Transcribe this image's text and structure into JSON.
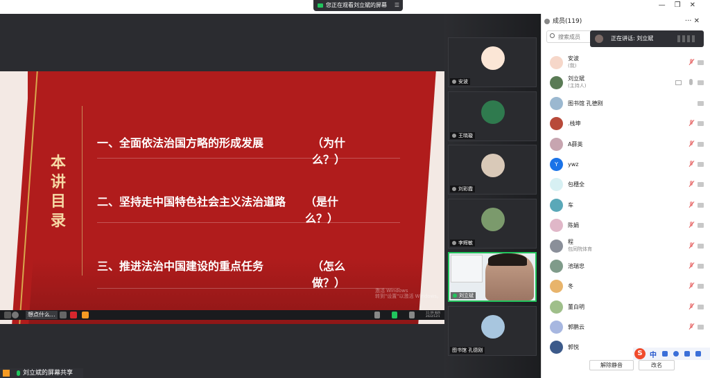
{
  "window": {
    "share_badge": "您正在观看刘立斌的屏幕",
    "buttons": [
      "—",
      "❐",
      "✕"
    ]
  },
  "slide": {
    "vertical_title": "本讲目录",
    "items": [
      {
        "text": "一、全面依法治国方略的形成发展",
        "q": "（为什么？）"
      },
      {
        "text": "二、坚持走中国特色社会主义法治道路",
        "q": "（是什么？）"
      },
      {
        "text": "三、推进法治中国建设的重点任务",
        "q": "（怎么做？）"
      }
    ],
    "watermark_line1": "激活 Windows",
    "watermark_line2": "转到\"设置\"以激活 Windows。"
  },
  "slide_taskbar": {
    "hint": "想点什么...",
    "time": "11:09 周四",
    "date": "2022/12/1"
  },
  "bottom_bar": {
    "label": "刘立斌的屏幕共享"
  },
  "tiles": [
    {
      "name": "安波"
    },
    {
      "name": "王晓璇"
    },
    {
      "name": "刘彩霞"
    },
    {
      "name": "李辉敏"
    },
    {
      "name": "刘立斌"
    },
    {
      "name": "图书馆 孔德刚"
    }
  ],
  "panel": {
    "title": "成员(119)",
    "controls": "··· ✕",
    "search_placeholder": "搜索成员",
    "speaking": "正在讲话: 刘立斌",
    "members": [
      {
        "name": "安波",
        "sub": "(我)"
      },
      {
        "name": "刘立斌",
        "sub": "(主持人)"
      },
      {
        "name": "图书馆 孔德刚",
        "sub": ""
      },
      {
        "name": ".栈坤",
        "sub": ""
      },
      {
        "name": "A薛英",
        "sub": ""
      },
      {
        "name": "ywz",
        "sub": ""
      },
      {
        "name": "包穗全",
        "sub": ""
      },
      {
        "name": "车",
        "sub": ""
      },
      {
        "name": "陈娟",
        "sub": ""
      },
      {
        "name": "程",
        "sub": "包同院体育"
      },
      {
        "name": "池瑞忠",
        "sub": ""
      },
      {
        "name": "冬",
        "sub": ""
      },
      {
        "name": "董白明",
        "sub": ""
      },
      {
        "name": "郭鹏云",
        "sub": ""
      },
      {
        "name": "郭悦",
        "sub": ""
      }
    ],
    "mute_all": "解除静音",
    "rename": "改名"
  },
  "ime": {
    "zh": "中"
  },
  "colors": {
    "accent_green": "#21c55d",
    "slide_red": "#b01c1c",
    "title_gold": "#f6d9a5"
  }
}
